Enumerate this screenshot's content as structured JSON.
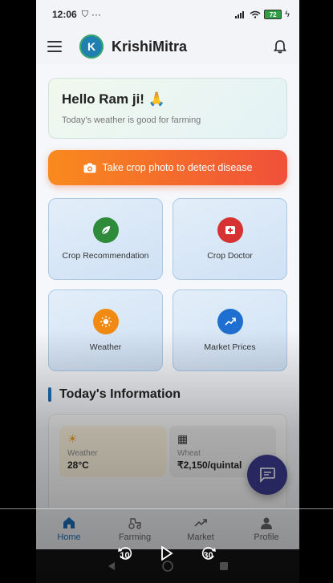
{
  "status_bar": {
    "time": "12:06",
    "battery": "72"
  },
  "app_bar": {
    "avatar_letter": "K",
    "title": "KrishiMitra"
  },
  "greeting": {
    "title": "Hello Ram ji! 🙏",
    "subtitle": "Today's weather is good for farming"
  },
  "cta": {
    "label": "Take crop photo to detect disease"
  },
  "tiles": [
    {
      "label": "Crop Recommendation",
      "icon": "leaf-icon",
      "color": "#2e8b3a"
    },
    {
      "label": "Crop Doctor",
      "icon": "medical-kit-icon",
      "color": "#d63232"
    },
    {
      "label": "Weather",
      "icon": "sun-icon",
      "color": "#f08a12"
    },
    {
      "label": "Market Prices",
      "icon": "trending-up-icon",
      "color": "#1f6fd0"
    }
  ],
  "section": {
    "title": "Today's Information"
  },
  "info": [
    {
      "label": "Weather",
      "value": "28°C",
      "icon": "sun-icon"
    },
    {
      "label": "Wheat",
      "value": "₹2,150/quintal",
      "icon": "grain-icon"
    }
  ],
  "bottom_nav": [
    {
      "label": "Home",
      "active": true
    },
    {
      "label": "Farming",
      "active": false
    },
    {
      "label": "Market",
      "active": false
    },
    {
      "label": "Profile",
      "active": false
    }
  ],
  "video_controls": {
    "rewind": "10",
    "forward": "30"
  }
}
